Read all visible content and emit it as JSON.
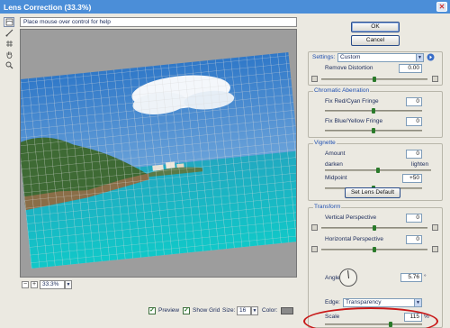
{
  "window": {
    "title": "Lens Correction (33.3%)"
  },
  "help": {
    "text": "Place mouse over control for help"
  },
  "tools": [
    {
      "name": "remove-distortion-tool-icon"
    },
    {
      "name": "straighten-tool-icon"
    },
    {
      "name": "move-grid-tool-icon"
    },
    {
      "name": "hand-tool-icon"
    },
    {
      "name": "zoom-tool-icon"
    }
  ],
  "buttons": {
    "ok": "OK",
    "cancel": "Cancel",
    "set_lens_default": "Set Lens Default"
  },
  "settings": {
    "label": "Settings:",
    "value": "Custom"
  },
  "remove_distortion": {
    "label": "Remove Distortion",
    "value": "0.00"
  },
  "chromatic": {
    "title": "Chromatic Aberration",
    "red_cyan": {
      "label": "Fix Red/Cyan Fringe",
      "value": "0"
    },
    "blue_yellow": {
      "label": "Fix Blue/Yellow Fringe",
      "value": "0"
    }
  },
  "vignette": {
    "title": "Vignette",
    "amount": {
      "label": "Amount",
      "value": "0"
    },
    "darken": "darken",
    "lighten": "lighten",
    "midpoint": {
      "label": "Midpoint",
      "value": "+50"
    }
  },
  "transform": {
    "title": "Transform",
    "vertical": {
      "label": "Vertical Perspective",
      "value": "0"
    },
    "horizontal": {
      "label": "Horizontal Perspective",
      "value": "0"
    },
    "angle": {
      "label": "Angle:",
      "value": "5.76"
    },
    "edge": {
      "label": "Edge:",
      "value": "Transparency"
    },
    "scale": {
      "label": "Scale",
      "value": "115",
      "unit": "%"
    }
  },
  "zoom": {
    "value": "33.3%"
  },
  "bottom": {
    "preview": "Preview",
    "show_grid": "Show Grid",
    "size_label": "Size:",
    "size_value": "16",
    "color_label": "Color:"
  },
  "colors": {
    "titlebar": "#4b8ed8",
    "accent_label": "#2050b0",
    "highlight": "#c81818"
  }
}
